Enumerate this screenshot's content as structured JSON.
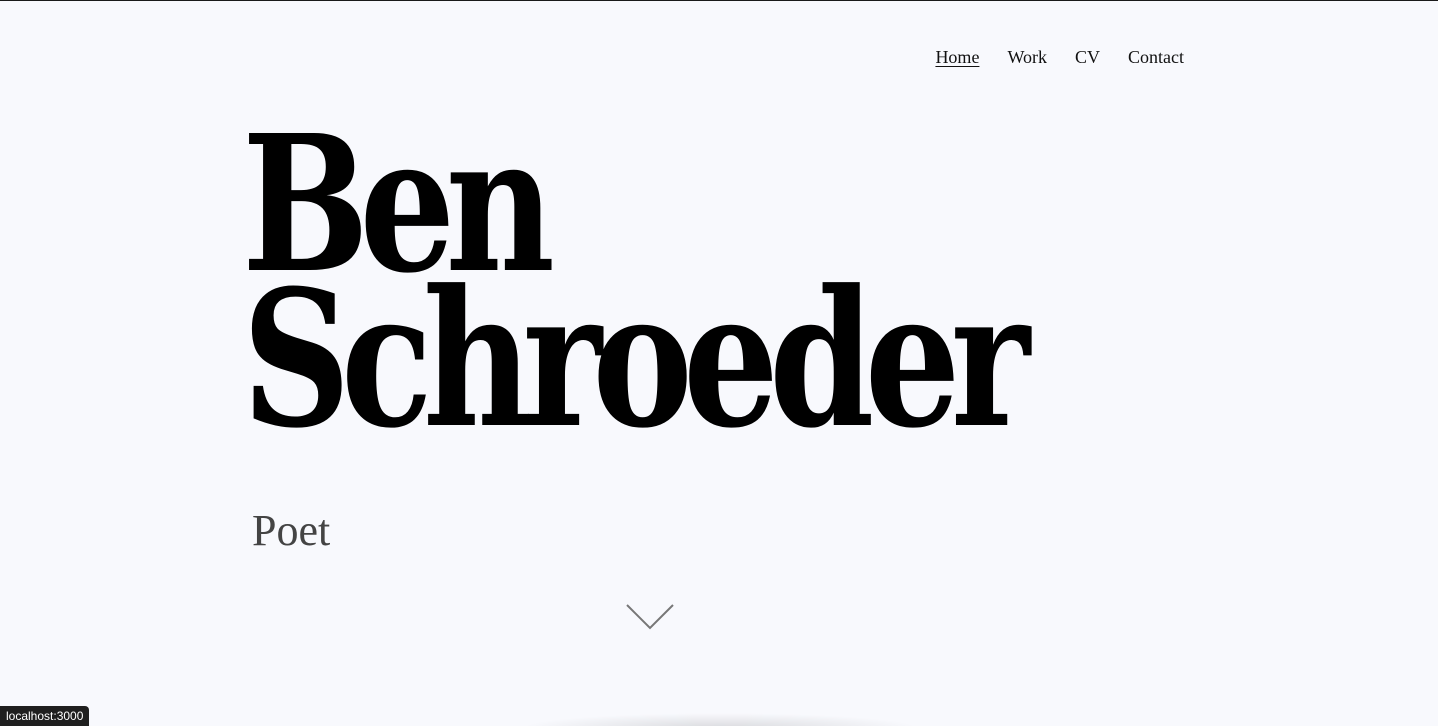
{
  "nav": {
    "items": [
      {
        "label": "Home",
        "active": true
      },
      {
        "label": "Work",
        "active": false
      },
      {
        "label": "CV",
        "active": false
      },
      {
        "label": "Contact",
        "active": false
      }
    ]
  },
  "hero": {
    "first_name": "Ben",
    "last_name": "Schroeder",
    "subtitle": "Poet"
  },
  "icons": {
    "scroll": "chevron-down-icon"
  },
  "status_bar": {
    "url": "localhost:3000"
  },
  "colors": {
    "background": "#f8f9fd",
    "text": "#000000",
    "subtitle": "#444444",
    "chevron": "#777777"
  }
}
